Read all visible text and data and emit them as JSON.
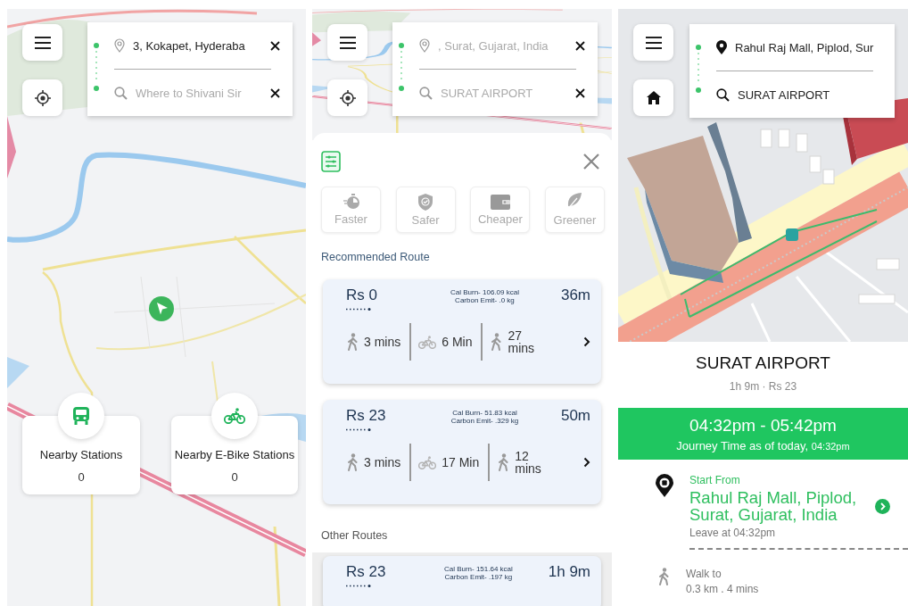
{
  "screens": [
    {
      "kind": "home",
      "search": {
        "dimmed": false,
        "clear_buttons": true,
        "from": {
          "value": "3, Kokapet, Hyderaba"
        },
        "to": {
          "placeholder": "Where to Shivani Sir"
        }
      },
      "nearby": [
        {
          "kind": "bus",
          "label": "Nearby Stations",
          "count": "0"
        },
        {
          "kind": "bike",
          "label": "Nearby E-Bike Stations",
          "count": "0"
        }
      ]
    },
    {
      "kind": "routes",
      "search": {
        "dimmed": true,
        "clear_buttons": true,
        "from": {
          "value": ", Surat, Gujarat, India"
        },
        "to": {
          "value": "SURAT AIRPORT"
        }
      },
      "filters": [
        {
          "kind": "faster",
          "label": "Faster",
          "selected": false
        },
        {
          "kind": "safer",
          "label": "Safer",
          "selected": false
        },
        {
          "kind": "cheaper",
          "label": "Cheaper",
          "selected": false
        },
        {
          "kind": "greener",
          "label": "Greener",
          "selected": false
        }
      ],
      "sections": [
        {
          "title": "Recommended Route",
          "routes": [
            {
              "price": "Rs 0",
              "cal_burn": "Cal Burn- 106.09 kcal",
              "carbon_emit": "Carbon Emit- .0 kg",
              "duration": "36m",
              "legs": [
                {
                  "kind": "walk",
                  "text": "3 mins"
                },
                {
                  "kind": "bike",
                  "text": "6 Min"
                },
                {
                  "kind": "walk",
                  "text": "27 mins"
                }
              ]
            },
            {
              "price": "Rs 23",
              "cal_burn": "Cal Burn- 51.83 kcal",
              "carbon_emit": "Carbon Emit- .329 kg",
              "duration": "50m",
              "legs": [
                {
                  "kind": "walk",
                  "text": "3 mins"
                },
                {
                  "kind": "bike",
                  "text": "17 Min"
                },
                {
                  "kind": "walk",
                  "text": "12 mins"
                }
              ]
            }
          ]
        },
        {
          "title": "Other Routes",
          "routes": [
            {
              "price": "Rs 23",
              "cal_burn": "Cal Burn- 151.64 kcal",
              "carbon_emit": "Carbon Emit- .197 kg",
              "duration": "1h 9m"
            }
          ]
        }
      ]
    },
    {
      "kind": "detail",
      "search": {
        "dimmed": false,
        "clear_buttons": false,
        "from": {
          "value": "Rahul Raj Mall, Piplod, Sur"
        },
        "to": {
          "value": "SURAT AIRPORT"
        }
      },
      "detail": {
        "title": "SURAT AIRPORT",
        "subtitle": "1h 9m · Rs 23",
        "time_range": "04:32pm - 05:42pm",
        "journey_label": "Journey Time as of today,",
        "journey_time": "04:32pm",
        "steps": [
          {
            "kind": "start",
            "label": "Start From",
            "place": "Rahul Raj Mall, Piplod, Surat, Gujarat, India",
            "note": "Leave at 04:32pm"
          },
          {
            "kind": "walk",
            "label": "Walk to",
            "note": "0.3 km . 4 mins"
          }
        ]
      }
    }
  ]
}
